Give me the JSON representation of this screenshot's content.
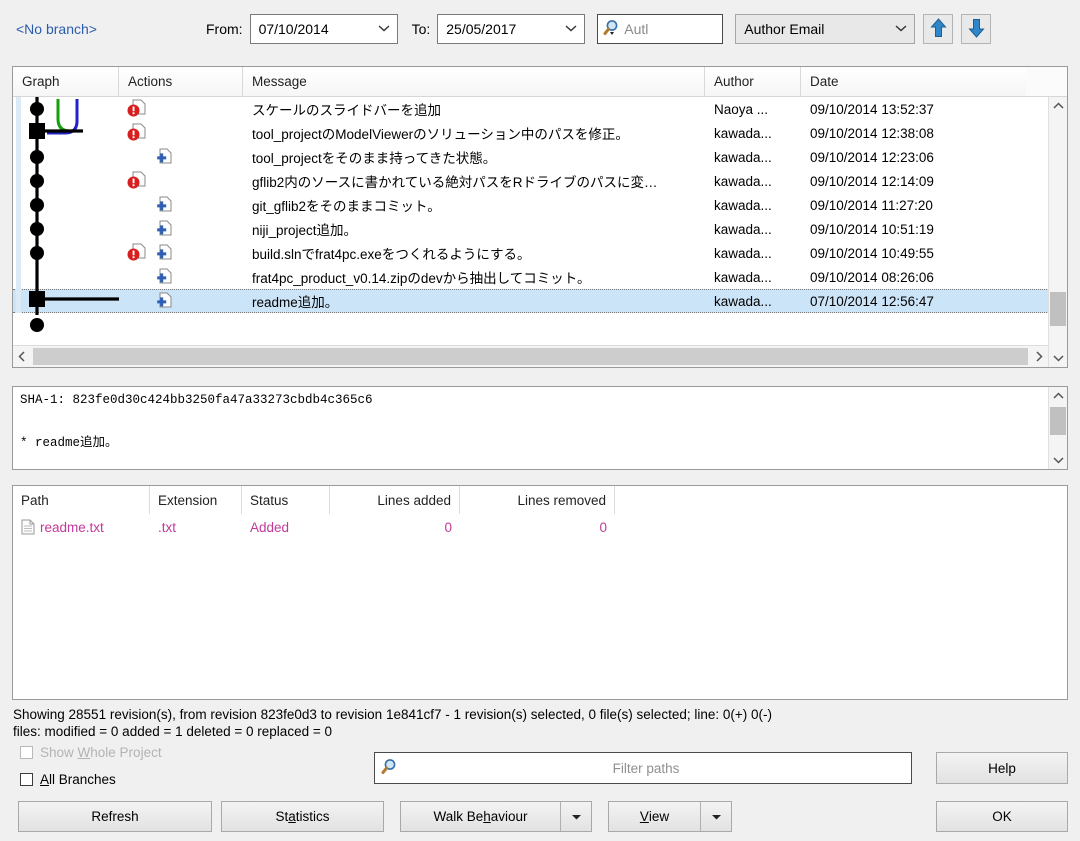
{
  "toolbar": {
    "branch": "<No branch>",
    "from_label": "From:",
    "from_value": "07/10/2014",
    "to_label": "To:",
    "to_value": "25/05/2017",
    "search_value": "Autl",
    "search_field_select": "Author Email",
    "up_arrow_icon": "arrow-up-icon",
    "down_arrow_icon": "arrow-down-icon",
    "search_icon": "search-icon"
  },
  "commit_table": {
    "columns": [
      "Graph",
      "Actions",
      "Message",
      "Author",
      "Date"
    ],
    "rows": [
      {
        "actions": [
          "modified"
        ],
        "message": "スケールのスライドバーを追加",
        "author": "Naoya ...",
        "date": "09/10/2014 13:52:37",
        "selected": false
      },
      {
        "actions": [
          "modified"
        ],
        "message": "tool_projectのModelViewerのソリューション中のパスを修正。",
        "author": "kawada...",
        "date": "09/10/2014 12:38:08",
        "selected": false
      },
      {
        "actions": [
          "added"
        ],
        "message": "tool_projectをそのまま持ってきた状態。",
        "author": "kawada...",
        "date": "09/10/2014 12:23:06",
        "selected": false
      },
      {
        "actions": [
          "modified"
        ],
        "message": "gflib2内のソースに書かれている絶対パスをRドライブのパスに変…",
        "author": "kawada...",
        "date": "09/10/2014 12:14:09",
        "selected": false
      },
      {
        "actions": [
          "added"
        ],
        "message": "git_gflib2をそのままコミット。",
        "author": "kawada...",
        "date": "09/10/2014 11:27:20",
        "selected": false
      },
      {
        "actions": [
          "added"
        ],
        "message": "niji_project追加。",
        "author": "kawada...",
        "date": "09/10/2014 10:51:19",
        "selected": false
      },
      {
        "actions": [
          "modified",
          "added"
        ],
        "message": "build.slnでfrat4pc.exeをつくれるようにする。",
        "author": "kawada...",
        "date": "09/10/2014 10:49:55",
        "selected": false
      },
      {
        "actions": [
          "added"
        ],
        "message": "frat4pc_product_v0.14.zipのdevから抽出してコミット。",
        "author": "kawada...",
        "date": "09/10/2014 08:26:06",
        "selected": false
      },
      {
        "actions": [
          "added"
        ],
        "message": "readme追加。",
        "author": "kawada...",
        "date": "07/10/2014 12:56:47",
        "selected": true
      }
    ]
  },
  "detail": {
    "sha_line": "SHA-1: 823fe0d30c424bb3250fa47a33273cbdb4c365c6",
    "blank_line": "",
    "message_line": "* readme追加。"
  },
  "files_table": {
    "columns": [
      "Path",
      "Extension",
      "Status",
      "Lines added",
      "Lines removed"
    ],
    "rows": [
      {
        "path": "readme.txt",
        "extension": ".txt",
        "status": "Added",
        "lines_added": "0",
        "lines_removed": "0",
        "file_icon": "document-icon"
      }
    ]
  },
  "status": {
    "line1": "Showing 28551 revision(s), from revision 823fe0d3 to revision 1e841cf7 - 1 revision(s) selected, 0 file(s) selected; line: 0(+) 0(-)",
    "line2": "files: modified = 0 added = 1 deleted = 0 replaced = 0"
  },
  "bottom": {
    "show_whole_project": "Show Whole Project",
    "show_whole_project_pre": "Show ",
    "show_whole_project_accel": "W",
    "show_whole_project_post": "hole Project",
    "all_branches_pre": "",
    "all_branches_accel": "A",
    "all_branches_post": "ll Branches",
    "filter_placeholder": "Filter paths",
    "filter_value": "",
    "help": "Help",
    "ok": "OK",
    "refresh": "Refresh",
    "statistics_pre": "St",
    "statistics_accel": "a",
    "statistics_post": "tistics",
    "walk_pre": "Walk Be",
    "walk_accel": "h",
    "walk_post": "aviour",
    "view_accel": "V",
    "view_post": "iew",
    "search_icon": "search-icon"
  },
  "colors": {
    "selection": "#cce4f7",
    "link": "#2a5db0",
    "file_text": "#c1399a",
    "branch_green": "#14a10a",
    "branch_blue": "#2222c8",
    "action_red": "#d81f1f",
    "action_blue": "#2c5fb5"
  }
}
